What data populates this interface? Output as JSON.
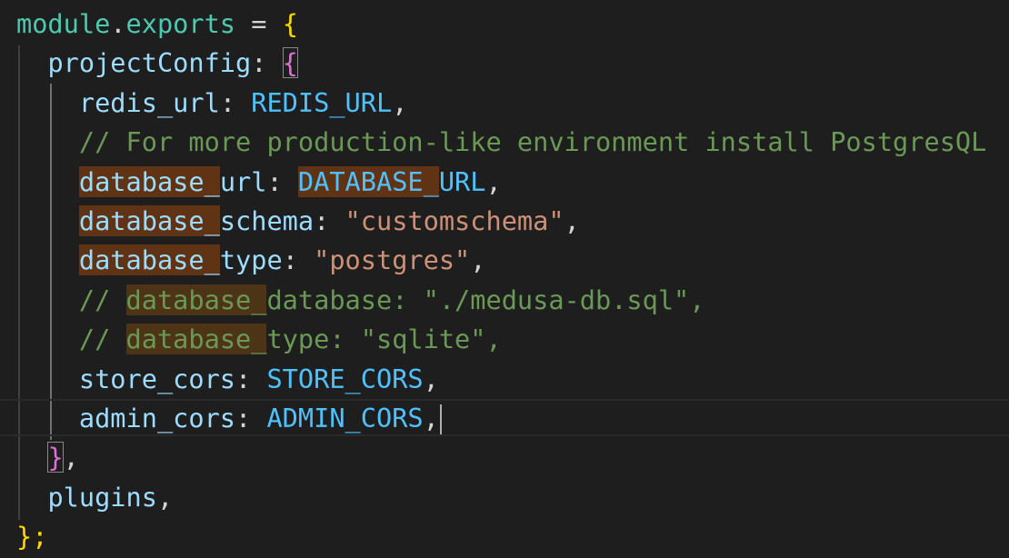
{
  "editor": {
    "module_keyword": "module",
    "exports_keyword": "exports",
    "equals": "=",
    "open_brace": "{",
    "close_brace_statement": "};",
    "project_config_key": "projectConfig",
    "colon": ":",
    "config_open_brace": "{",
    "config_close_brace": "}",
    "comma": ",",
    "plugins_key": "plugins",
    "redis_url": {
      "key": "redis_url",
      "value": "REDIS_URL"
    },
    "comment_postgres": "// For more production-like environment install PostgresQL",
    "database_url": {
      "key_hl": "database_",
      "key_rest": "url",
      "value_hl": "DATABASE_",
      "value_rest": "URL"
    },
    "database_schema": {
      "key_hl": "database_",
      "key_rest": "schema",
      "value": "\"customschema\""
    },
    "database_type": {
      "key_hl": "database_",
      "key_rest": "type",
      "value": "\"postgres\""
    },
    "comment_database_database": {
      "prefix": "// ",
      "hl": "database_",
      "rest": "database: \"./medusa-db.sql\","
    },
    "comment_database_type": {
      "prefix": "// ",
      "hl": "database_",
      "rest": "type: \"sqlite\","
    },
    "store_cors": {
      "key": "store_cors",
      "value": "STORE_CORS"
    },
    "admin_cors": {
      "key": "admin_cors",
      "value": "ADMIN_CORS"
    }
  },
  "colors": {
    "background": "#1e1e1e",
    "property": "#9cdcfe",
    "constant": "#4fc1ff",
    "string": "#ce9178",
    "comment": "#6a9955",
    "bracket_level_1": "#ffd700",
    "bracket_level_2": "#da70d6",
    "selection_highlight": "#613315"
  }
}
